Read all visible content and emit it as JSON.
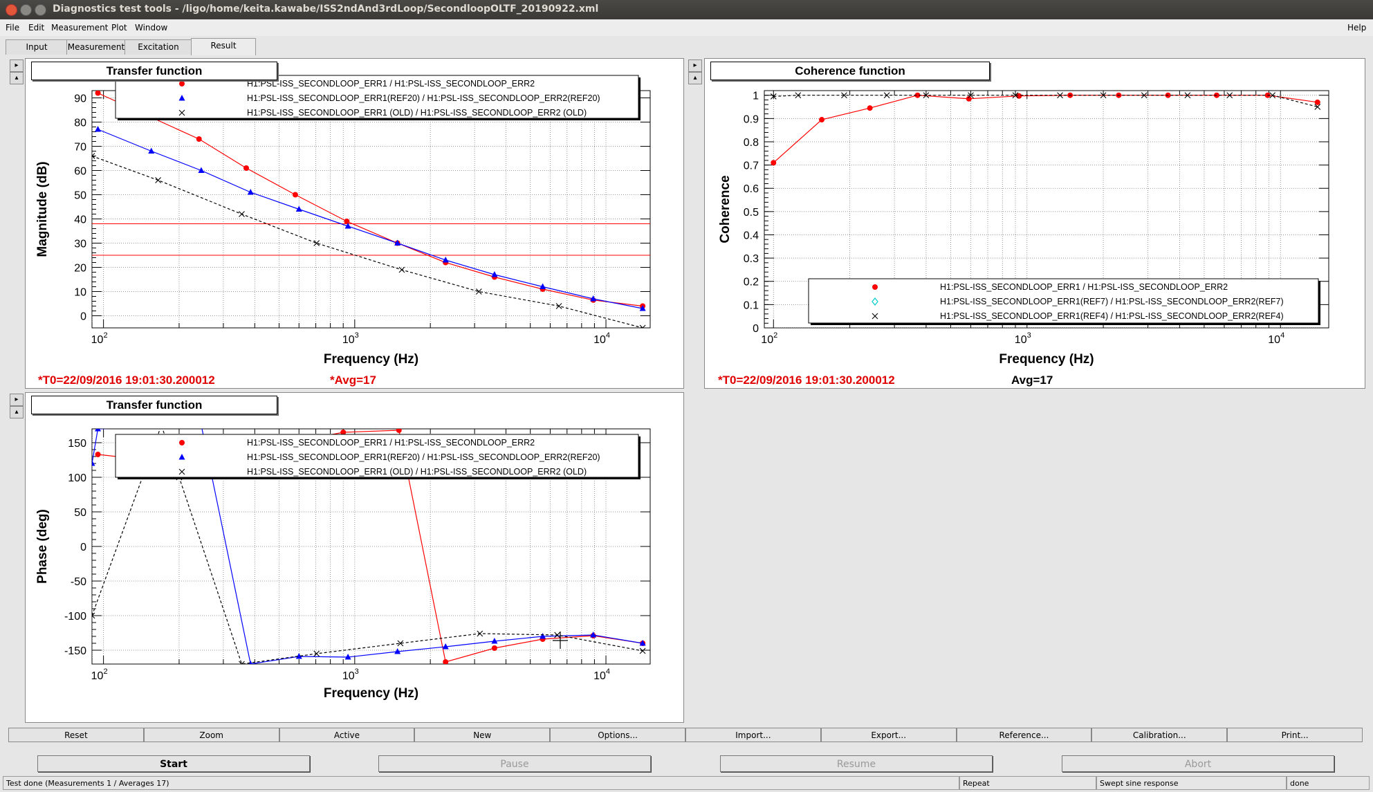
{
  "window": {
    "title": "Diagnostics test tools - /ligo/home/keita.kawabe/ISS2ndAnd3rdLoop/SecondloopOLTF_20190922.xml"
  },
  "menubar": {
    "file": "File",
    "edit": "Edit",
    "measurement": "Measurement",
    "plot": "Plot",
    "window": "Window",
    "help": "Help"
  },
  "tabs": {
    "input": "Input",
    "measurement": "Measurement",
    "excitation": "Excitation",
    "result": "Result"
  },
  "colors": {
    "series_main": "#ff0000",
    "series_ref": "#0000ff",
    "series_old": "#000000",
    "ref7": "#00cccc"
  },
  "panels": {
    "magnitude": {
      "title": "Transfer function",
      "ylabel": "Magnitude (dB)",
      "xlabel": "Frequency (Hz)",
      "t0": "*T0=22/09/2016 19:01:30.200012",
      "avg": "*Avg=17",
      "legend": [
        "H1:PSL-ISS_SECONDLOOP_ERR1 / H1:PSL-ISS_SECONDLOOP_ERR2",
        "H1:PSL-ISS_SECONDLOOP_ERR1(REF20) / H1:PSL-ISS_SECONDLOOP_ERR2(REF20)",
        "H1:PSL-ISS_SECONDLOOP_ERR1 (OLD) / H1:PSL-ISS_SECONDLOOP_ERR2 (OLD)"
      ],
      "yticks": [
        "90",
        "80",
        "70",
        "60",
        "50",
        "40",
        "30",
        "20",
        "10",
        "0"
      ]
    },
    "coherence": {
      "title": "Coherence function",
      "ylabel": "Coherence",
      "xlabel": "Frequency (Hz)",
      "t0": "*T0=22/09/2016 19:01:30.200012",
      "avg": "Avg=17",
      "legend": [
        "H1:PSL-ISS_SECONDLOOP_ERR1 / H1:PSL-ISS_SECONDLOOP_ERR2",
        "H1:PSL-ISS_SECONDLOOP_ERR1(REF7) / H1:PSL-ISS_SECONDLOOP_ERR2(REF7)",
        "H1:PSL-ISS_SECONDLOOP_ERR1(REF4) / H1:PSL-ISS_SECONDLOOP_ERR2(REF4)"
      ],
      "yticks": [
        "1",
        "0.9",
        "0.8",
        "0.7",
        "0.6",
        "0.5",
        "0.4",
        "0.3",
        "0.2",
        "0.1",
        "0"
      ]
    },
    "phase": {
      "title": "Transfer function",
      "ylabel": "Phase (deg)",
      "xlabel": "Frequency (Hz)",
      "legend": [
        "H1:PSL-ISS_SECONDLOOP_ERR1 / H1:PSL-ISS_SECONDLOOP_ERR2",
        "H1:PSL-ISS_SECONDLOOP_ERR1(REF20) / H1:PSL-ISS_SECONDLOOP_ERR2(REF20)",
        "H1:PSL-ISS_SECONDLOOP_ERR1 (OLD) / H1:PSL-ISS_SECONDLOOP_ERR2 (OLD)"
      ],
      "yticks": [
        "150",
        "100",
        "50",
        "0",
        "-50",
        "-100",
        "-150"
      ]
    }
  },
  "toolbar": [
    "Reset",
    "Zoom",
    "Active",
    "New",
    "Options...",
    "Import...",
    "Export...",
    "Reference...",
    "Calibration...",
    "Print..."
  ],
  "controls": {
    "start": "Start",
    "pause": "Pause",
    "resume": "Resume",
    "abort": "Abort"
  },
  "statusbar": {
    "message": "Test done (Measurements 1 / Averages 17)",
    "mode": "Repeat",
    "type": "Swept sine response",
    "state": "done"
  },
  "chart_data": [
    {
      "id": "magnitude",
      "type": "line",
      "title": "Transfer function",
      "xlabel": "Frequency (Hz)",
      "ylabel": "Magnitude (dB)",
      "xscale": "log",
      "xlim": [
        90,
        15000
      ],
      "ylim": [
        -5,
        93
      ],
      "hlines": [
        38,
        25
      ],
      "series": [
        {
          "name": "H1:PSL-ISS_SECONDLOOP_ERR1 / H1:PSL-ISS_SECONDLOOP_ERR2",
          "color": "#ff0000",
          "marker": "circle",
          "x": [
            95,
            240,
            370,
            580,
            930,
            1480,
            2300,
            3600,
            5600,
            8900,
            14000
          ],
          "y": [
            92,
            73,
            61,
            50,
            39,
            30,
            22,
            16,
            11,
            6.5,
            4
          ]
        },
        {
          "name": "H1:PSL-ISS_SECONDLOOP_ERR1(REF20) / H1:PSL-ISS_SECONDLOOP_ERR2(REF20)",
          "color": "#0000ff",
          "marker": "triangle",
          "x": [
            95,
            155,
            245,
            385,
            600,
            940,
            1480,
            2300,
            3600,
            5600,
            8900,
            14000
          ],
          "y": [
            77,
            68,
            60,
            51,
            44,
            37,
            30,
            23,
            17,
            12,
            7,
            3
          ]
        },
        {
          "name": "H1:PSL-ISS_SECONDLOOP_ERR1 (OLD) / H1:PSL-ISS_SECONDLOOP_ERR2 (OLD)",
          "color": "#000000",
          "marker": "cross",
          "x": [
            90,
            165,
            355,
            705,
            1540,
            3120,
            6500,
            14000
          ],
          "y": [
            66,
            56,
            42,
            30,
            19,
            10,
            4,
            -5
          ]
        }
      ]
    },
    {
      "id": "coherence",
      "type": "line",
      "title": "Coherence function",
      "xlabel": "Frequency (Hz)",
      "ylabel": "Coherence",
      "xscale": "log",
      "xlim": [
        92,
        15500
      ],
      "ylim": [
        0,
        1.02
      ],
      "series": [
        {
          "name": "H1:PSL-ISS_SECONDLOOP_ERR1 / H1:PSL-ISS_SECONDLOOP_ERR2",
          "color": "#ff0000",
          "marker": "circle",
          "x": [
            100,
            155,
            240,
            370,
            590,
            930,
            1480,
            2300,
            3600,
            5600,
            8900,
            14000
          ],
          "y": [
            0.71,
            0.895,
            0.945,
            1.0,
            0.985,
            0.997,
            1.0,
            1.0,
            1.0,
            1.0,
            1.0,
            0.97
          ]
        },
        {
          "name": "H1:PSL-ISS_SECONDLOOP_ERR1(REF7) / H1:PSL-ISS_SECONDLOOP_ERR2(REF7)",
          "color": "#00cccc",
          "marker": "diamond",
          "x": [],
          "y": []
        },
        {
          "name": "H1:PSL-ISS_SECONDLOOP_ERR1(REF4) / H1:PSL-ISS_SECONDLOOP_ERR2(REF4)",
          "color": "#000000",
          "marker": "cross",
          "x": [
            100,
            125,
            190,
            280,
            400,
            600,
            900,
            1350,
            2000,
            2900,
            4300,
            6300,
            9300,
            14000
          ],
          "y": [
            0.995,
            1.0,
            1.0,
            1.0,
            1.0,
            1.0,
            1.0,
            1.0,
            1.0,
            1.0,
            1.0,
            1.0,
            1.0,
            0.95
          ]
        }
      ]
    },
    {
      "id": "phase",
      "type": "line",
      "title": "Transfer function",
      "xlabel": "Frequency (Hz)",
      "ylabel": "Phase (deg)",
      "xscale": "log",
      "xlim": [
        90,
        15000
      ],
      "ylim": [
        -170,
        170
      ],
      "series": [
        {
          "name": "H1:PSL-ISS_SECONDLOOP_ERR1 / H1:PSL-ISS_SECONDLOOP_ERR2",
          "color": "#ff0000",
          "marker": "circle",
          "x": [
            95,
            200,
            900,
            1500,
            2300,
            3600,
            5600,
            8900,
            14000
          ],
          "y": [
            133,
            120,
            165,
            168,
            -167,
            -147,
            -134,
            -129,
            -140
          ]
        },
        {
          "name": "H1:PSL-ISS_SECONDLOOP_ERR1(REF20) / H1:PSL-ISS_SECONDLOOP_ERR2(REF20)",
          "color": "#0000ff",
          "marker": "triangle",
          "x": [
            90,
            95,
            245,
            385,
            600,
            940,
            1480,
            2300,
            3600,
            5600,
            8900,
            14000
          ],
          "y": [
            120,
            170,
            175,
            -170,
            -159,
            -160,
            -152,
            -145,
            -137,
            -130,
            -128,
            -140
          ]
        },
        {
          "name": "H1:PSL-ISS_SECONDLOOP_ERR1 (OLD) / H1:PSL-ISS_SECONDLOOP_ERR2 (OLD)",
          "color": "#000000",
          "marker": "cross",
          "x": [
            90,
            170,
            200,
            355,
            705,
            1520,
            3150,
            6400,
            14000
          ],
          "y": [
            -100,
            175,
            100,
            -170,
            -155,
            -140,
            -126,
            -128,
            -151
          ]
        }
      ]
    }
  ]
}
